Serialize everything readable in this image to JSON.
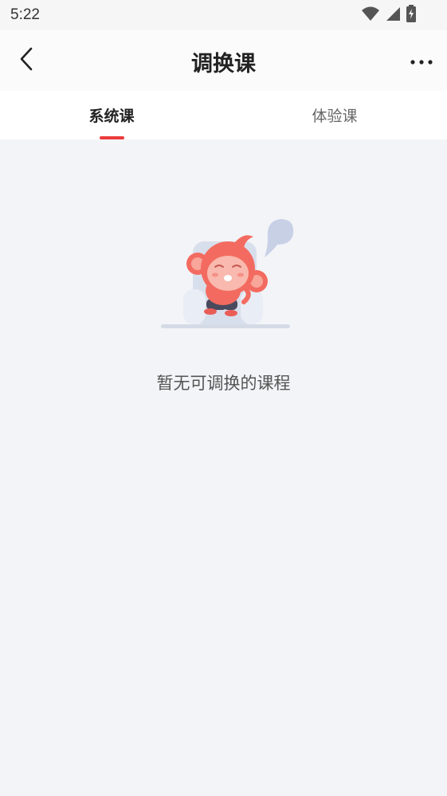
{
  "status_bar": {
    "time": "5:22",
    "icons": [
      "wifi-icon",
      "cellular-signal-icon",
      "battery-charging-icon"
    ]
  },
  "header": {
    "title": "调换课",
    "back_icon": "chevron-left-icon",
    "more_icon": "more-horizontal-icon"
  },
  "tabs": [
    {
      "label": "系统课",
      "active": true
    },
    {
      "label": "体验课",
      "active": false
    }
  ],
  "empty_state": {
    "illustration": "sleeping-monkey-illustration",
    "message": "暂无可调换的课程"
  },
  "colors": {
    "accent": "#ec3b3b",
    "background": "#f3f4f7",
    "monkey": "#f36b60"
  }
}
